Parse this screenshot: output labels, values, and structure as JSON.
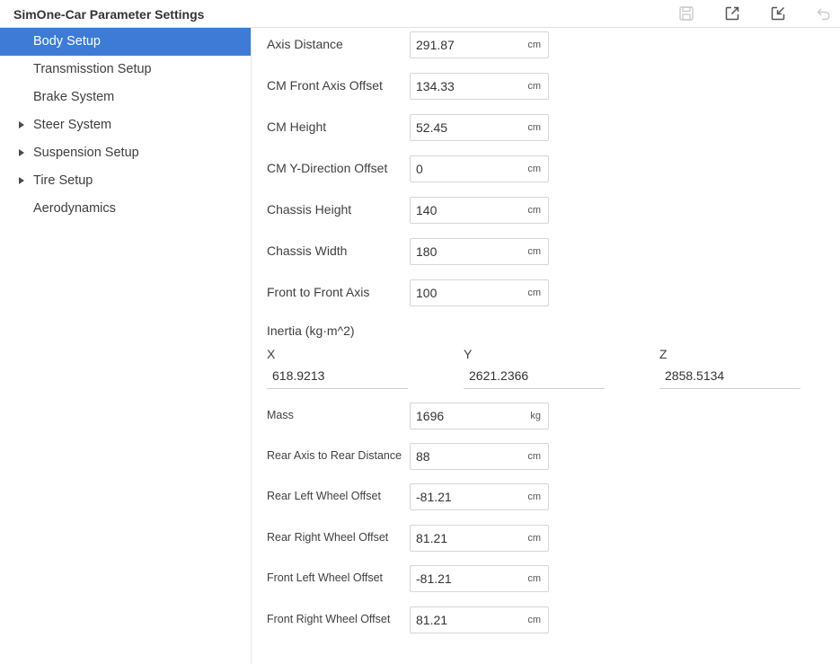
{
  "app": {
    "title": "SimOne-Car Parameter Settings"
  },
  "toolbar": {
    "icons": [
      "save-icon",
      "export-icon",
      "import-icon",
      "undo-icon"
    ]
  },
  "sidebar": {
    "items": [
      {
        "label": "Body Setup",
        "active": true,
        "expandable": false
      },
      {
        "label": "Transmisstion Setup",
        "active": false,
        "expandable": false
      },
      {
        "label": "Brake System",
        "active": false,
        "expandable": false
      },
      {
        "label": "Steer System",
        "active": false,
        "expandable": true
      },
      {
        "label": "Suspension Setup",
        "active": false,
        "expandable": true
      },
      {
        "label": "Tire Setup",
        "active": false,
        "expandable": true
      },
      {
        "label": "Aerodynamics",
        "active": false,
        "expandable": false
      }
    ]
  },
  "fields": {
    "axis_distance": {
      "label": "Axis Distance",
      "value": "291.87",
      "unit": "cm"
    },
    "cm_front_axis_offset": {
      "label": "CM Front Axis Offset",
      "value": "134.33",
      "unit": "cm"
    },
    "cm_height": {
      "label": "CM Height",
      "value": "52.45",
      "unit": "cm"
    },
    "cm_y_offset": {
      "label": "CM Y-Direction Offset",
      "value": "0",
      "unit": "cm"
    },
    "chassis_height": {
      "label": "Chassis Height",
      "value": "140",
      "unit": "cm"
    },
    "chassis_width": {
      "label": "Chassis Width",
      "value": "180",
      "unit": "cm"
    },
    "front_to_front_axis": {
      "label": "Front to Front Axis",
      "value": "100",
      "unit": "cm"
    },
    "mass": {
      "label": "Mass",
      "value": "1696",
      "unit": "kg"
    },
    "rear_axis_to_rear_distance": {
      "label": "Rear Axis to Rear Distance",
      "value": "88",
      "unit": "cm"
    },
    "rear_left_wheel_offset": {
      "label": "Rear Left Wheel Offset",
      "value": "-81.21",
      "unit": "cm"
    },
    "rear_right_wheel_offset": {
      "label": "Rear Right Wheel Offset",
      "value": "81.21",
      "unit": "cm"
    },
    "front_left_wheel_offset": {
      "label": "Front Left Wheel Offset",
      "value": "-81.21",
      "unit": "cm"
    },
    "front_right_wheel_offset": {
      "label": "Front Right Wheel Offset",
      "value": "81.21",
      "unit": "cm"
    }
  },
  "inertia": {
    "title": "Inertia (kg·m^2)",
    "x": {
      "label": "X",
      "value": "618.9213"
    },
    "y": {
      "label": "Y",
      "value": "2621.2366"
    },
    "z": {
      "label": "Z",
      "value": "2858.5134"
    }
  },
  "colors": {
    "accent": "#3d7bd6",
    "border": "#d6d6d6",
    "text": "#3b3b3b"
  }
}
